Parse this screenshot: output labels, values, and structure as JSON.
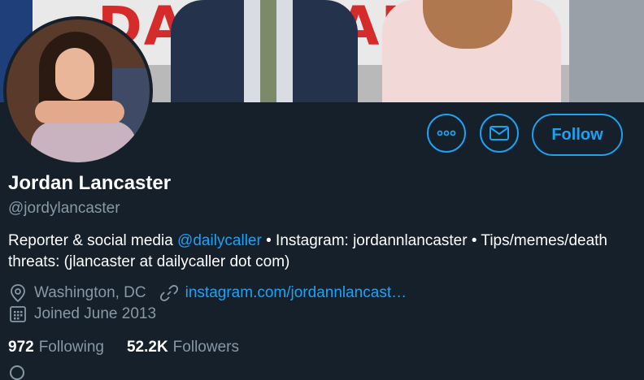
{
  "banner": {
    "sign_text": "DAILY CALLER"
  },
  "profile": {
    "name": "Jordan Lancaster",
    "handle": "@jordylancaster",
    "bio_part1": "Reporter & social media ",
    "bio_mention": "@dailycaller",
    "bio_part2": " • Instagram: jordannlancaster • Tips/memes/death threats: (jlancaster at dailycaller dot com)",
    "location": "Washington, DC",
    "website": "instagram.com/jordannlancast…",
    "joined": "Joined June 2013",
    "following_count": "972",
    "following_label": "Following",
    "followers_count": "52.2K",
    "followers_label": "Followers"
  },
  "actions": {
    "follow_label": "Follow"
  },
  "colors": {
    "accent": "#1da1f2",
    "background": "#15202b",
    "muted": "#8899a6"
  },
  "icons": [
    "more-icon",
    "mail-icon",
    "location-icon",
    "link-icon",
    "calendar-icon"
  ]
}
